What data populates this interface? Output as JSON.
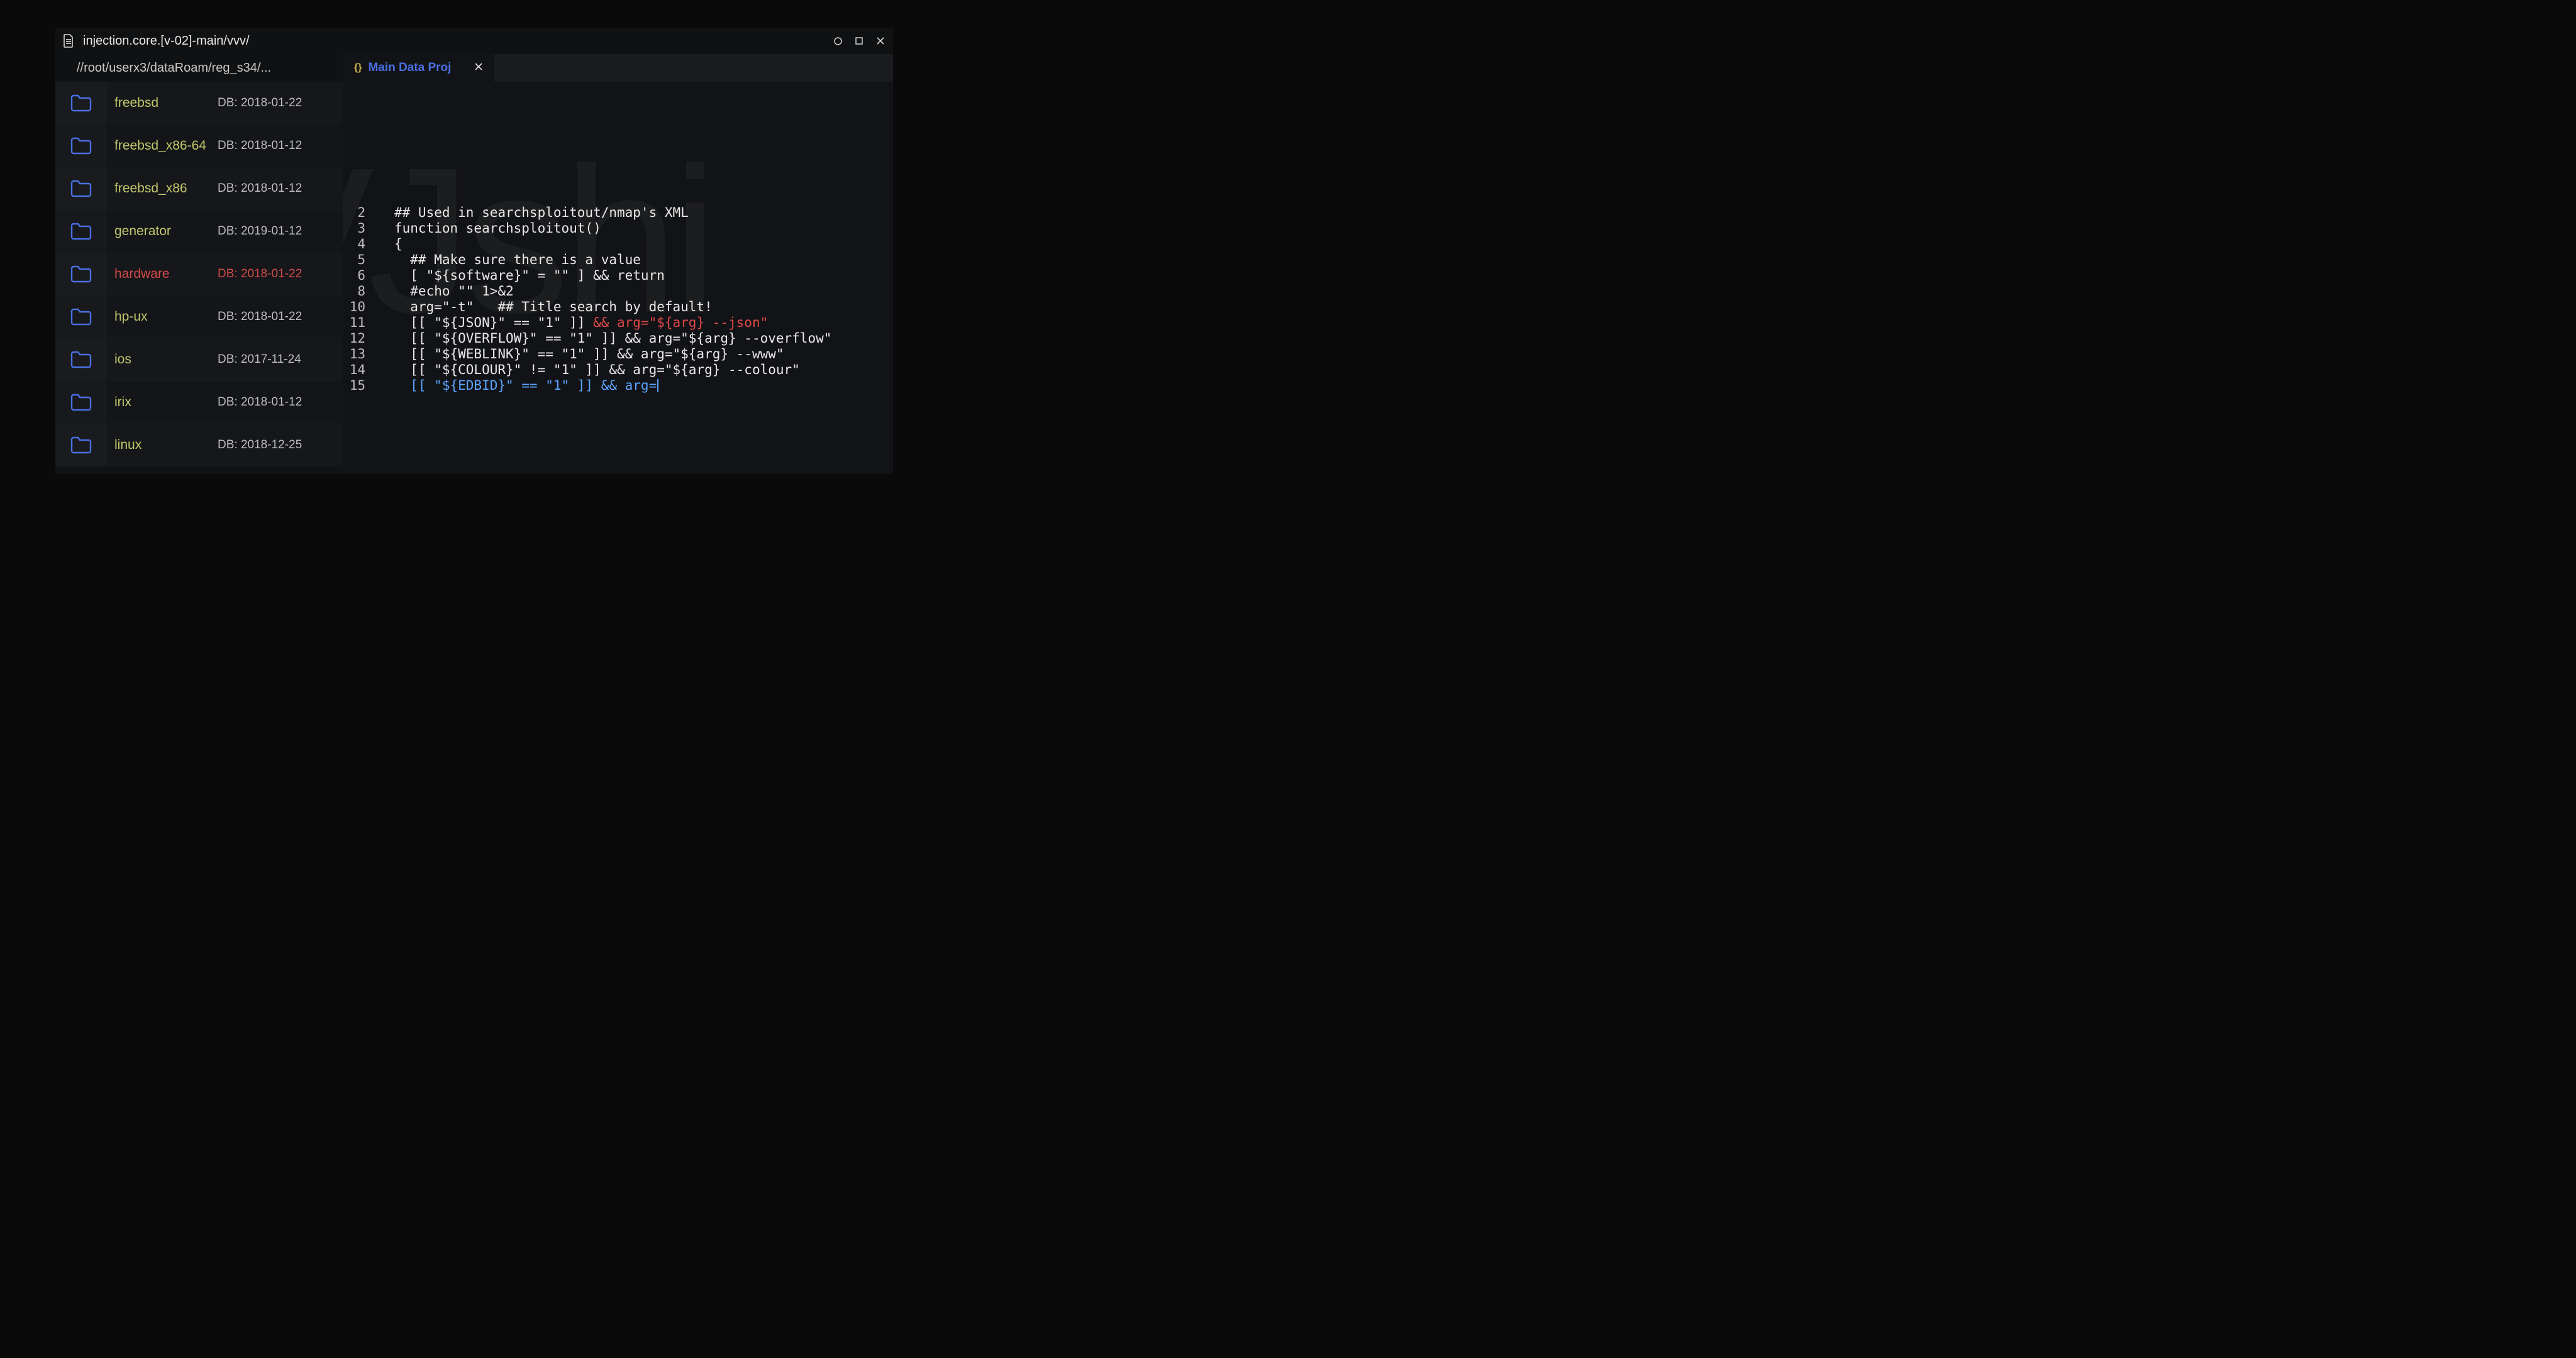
{
  "window": {
    "title": "injection.core.[v-02]-main/vvv/"
  },
  "sidebar": {
    "path": "//root/userx3/dataRoam/reg_s34/...",
    "items": [
      {
        "name": "freebsd",
        "date": "DB: 2018-01-22",
        "highlight": false
      },
      {
        "name": "freebsd_x86-64",
        "date": "DB: 2018-01-12",
        "highlight": false
      },
      {
        "name": "freebsd_x86",
        "date": "DB: 2018-01-12",
        "highlight": false
      },
      {
        "name": "generator",
        "date": "DB: 2019-01-12",
        "highlight": false
      },
      {
        "name": "hardware",
        "date": "DB: 2018-01-22",
        "highlight": true
      },
      {
        "name": "hp-ux",
        "date": "DB: 2018-01-22",
        "highlight": false
      },
      {
        "name": "ios",
        "date": "DB: 2017-11-24",
        "highlight": false
      },
      {
        "name": "irix",
        "date": "DB: 2018-01-12",
        "highlight": false
      },
      {
        "name": "linux",
        "date": "DB: 2018-12-25",
        "highlight": false
      }
    ]
  },
  "editor": {
    "tab": {
      "icon": "{}",
      "label": "Main Data Proj"
    },
    "watermark": "VJshi",
    "lines": [
      {
        "n": "2",
        "segs": [
          {
            "t": "## Used in searchsploitout/nmap's XML"
          }
        ]
      },
      {
        "n": "3",
        "segs": [
          {
            "t": "function searchsploitout()"
          }
        ]
      },
      {
        "n": "4",
        "segs": [
          {
            "t": "{"
          }
        ]
      },
      {
        "n": "5",
        "segs": [
          {
            "t": "  ## Make sure there is a value"
          }
        ]
      },
      {
        "n": "6",
        "segs": [
          {
            "t": "  [ \"${software}\" = \"\" ] && return"
          }
        ]
      },
      {
        "n": "",
        "segs": [
          {
            "t": ""
          }
        ]
      },
      {
        "n": "8",
        "segs": [
          {
            "t": "  #echo \"\" 1>&2"
          }
        ]
      },
      {
        "n": "",
        "segs": [
          {
            "t": ""
          }
        ]
      },
      {
        "n": "10",
        "segs": [
          {
            "t": "  arg=\"-t\"   ## Title search by default!"
          }
        ]
      },
      {
        "n": "11",
        "segs": [
          {
            "t": "  [[ \"${JSON}\" == \"1\" ]] "
          },
          {
            "t": "&& arg=\"${arg} --json\"",
            "c": "red"
          }
        ]
      },
      {
        "n": "12",
        "segs": [
          {
            "t": "  [[ \"${OVERFLOW}\" == \"1\" ]] && arg=\"${arg} --overflow\""
          }
        ]
      },
      {
        "n": "13",
        "segs": [
          {
            "t": "  [[ \"${WEBLINK}\" == \"1\" ]] && arg=\"${arg} --www\""
          }
        ]
      },
      {
        "n": "14",
        "segs": [
          {
            "t": "  [[ \"${COLOUR}\" != \"1\" ]] && arg=\"${arg} --colour\""
          }
        ]
      },
      {
        "n": "15",
        "segs": [
          {
            "t": "  [[ \"${EDBID}\" == \"1\" ]] && arg=",
            "c": "blue"
          }
        ],
        "cursor": true
      }
    ]
  }
}
